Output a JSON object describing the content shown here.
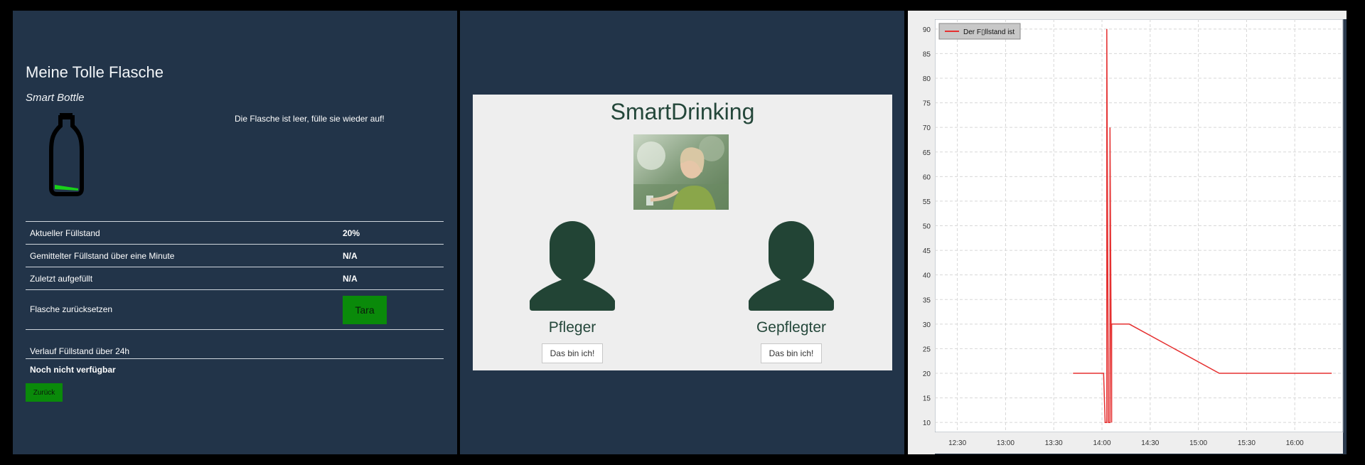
{
  "bottle_panel": {
    "title": "Meine Tolle Flasche",
    "subtitle": "Smart Bottle",
    "message": "Die Flasche ist leer, fülle sie wieder auf!",
    "fill_level": 0.2,
    "rows": [
      {
        "label": "Aktueller Füllstand",
        "value": "20%"
      },
      {
        "label": "Gemittelter Füllstand über eine Minute",
        "value": "N/A"
      },
      {
        "label": "Zuletzt aufgefüllt",
        "value": "N/A"
      },
      {
        "label": "Flasche zurücksetzen",
        "button": "Tara"
      }
    ],
    "history_label": "Verlauf Füllstand über 24h",
    "history_value": "Noch nicht verfügbar",
    "back_button": "Zurück",
    "accent": "#0a8a0a"
  },
  "login_panel": {
    "brand": "SmartDrinking",
    "roles": [
      {
        "label": "Pfleger",
        "button": "Das bin ich!"
      },
      {
        "label": "Gepflegter",
        "button": "Das bin ich!"
      }
    ],
    "brand_color": "#24473a"
  },
  "chart_data": {
    "type": "line",
    "legend": "Der F\u0000llstand ist",
    "legend_display": "Der F▯llstand ist",
    "legend_position": "top-left",
    "grid": true,
    "x_ticks": [
      "12:30",
      "13:00",
      "13:30",
      "14:00",
      "14:30",
      "15:00",
      "15:30",
      "16:00"
    ],
    "y_ticks": [
      10,
      15,
      20,
      25,
      30,
      35,
      40,
      45,
      50,
      55,
      60,
      65,
      70,
      75,
      80,
      85,
      90
    ],
    "xlim": [
      "12:16",
      "16:30"
    ],
    "ylim": [
      8,
      92
    ],
    "series": [
      {
        "color": "#e53030",
        "points": [
          [
            "13:42",
            20
          ],
          [
            "14:01",
            20
          ],
          [
            "14:02",
            10
          ],
          [
            "14:03",
            10
          ],
          [
            "14:03",
            90
          ],
          [
            "14:04",
            10
          ],
          [
            "14:05",
            10
          ],
          [
            "14:05",
            70
          ],
          [
            "14:06",
            10
          ],
          [
            "14:06",
            30
          ],
          [
            "14:17",
            30
          ],
          [
            "15:13",
            20
          ],
          [
            "16:23",
            20
          ]
        ]
      }
    ]
  }
}
